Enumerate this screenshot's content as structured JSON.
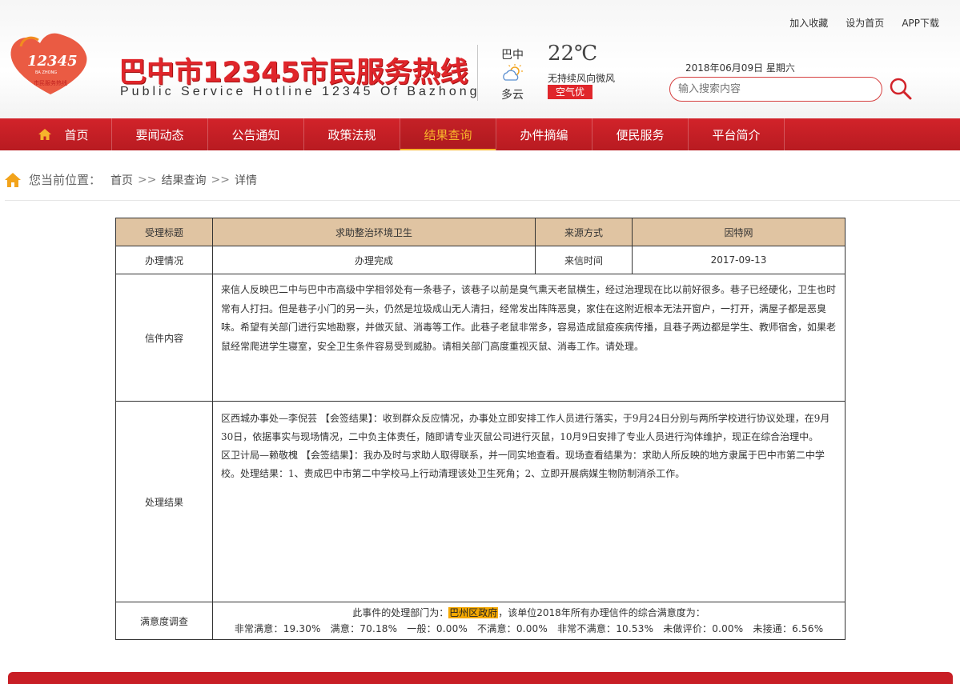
{
  "top_links": [
    "加入收藏",
    "设为首页",
    "APP下载"
  ],
  "logo": {
    "number": "12345",
    "sub_en": "BA ZHONG",
    "sub_cn": "市民服务热线"
  },
  "site_title_cn": "巴中市12345市民服务热线",
  "site_title_en": "Public Service Hotline 12345 Of Bazhong",
  "weather": {
    "city": "巴中",
    "desc": "多云",
    "temp": "22℃",
    "wind": "无持续风向微风",
    "aqi": "空气优"
  },
  "date": "2018年06月09日  星期六",
  "search": {
    "placeholder": "输入搜索内容"
  },
  "nav": {
    "items": [
      {
        "label": "首页"
      },
      {
        "label": "要闻动态"
      },
      {
        "label": "公告通知"
      },
      {
        "label": "政策法规"
      },
      {
        "label": "结果查询"
      },
      {
        "label": "办件摘编"
      },
      {
        "label": "便民服务"
      },
      {
        "label": "平台简介"
      }
    ],
    "active_index": 4
  },
  "breadcrumb": {
    "label": "您当前位置：",
    "items": [
      "首页",
      "结果查询",
      "详情"
    ],
    "sep": ">>"
  },
  "detail": {
    "row1": {
      "title_label": "受理标题",
      "title_value": "求助整治环境卫生",
      "source_label": "来源方式",
      "source_value": "因特网"
    },
    "row2": {
      "status_label": "办理情况",
      "status_value": "办理完成",
      "time_label": "来信时间",
      "time_value": "2017-09-13"
    },
    "content_label": "信件内容",
    "content": "来信人反映巴二中与巴中市高级中学相邻处有一条巷子，该巷子以前是臭气熏天老鼠横生，经过治理现在比以前好很多。巷子已经硬化，卫生也时常有人打扫。但是巷子小门的另一头，仍然是垃圾成山无人清扫，经常发出阵阵恶臭，家住在这附近根本无法开窗户，一打开，满屋子都是恶臭味。希望有关部门进行实地勘察，并做灭鼠、消毒等工作。此巷子老鼠非常多，容易造成鼠疫疾病传播，且巷子两边都是学生、教师宿舍，如果老鼠经常爬进学生寝室，安全卫生条件容易受到威胁。请相关部门高度重视灭鼠、消毒工作。请处理。",
    "result_label": "处理结果",
    "result_1": "区西城办事处—李倪芸 【会签结果】：收到群众反应情况，办事处立即安排工作人员进行落实，于9月24日分别与两所学校进行协议处理，在9月30日，依据事实与现场情况，二中负主体责任，随即请专业灭鼠公司进行灭鼠，10月9日安排了专业人员进行沟体维护，现正在综合治理中。",
    "result_2": "区卫计局—赖敬槐 【会签结果】：我办及时与求助人取得联系，并一同实地查看。现场查看结果为：求助人所反映的地方隶属于巴中市第二中学校。处理结果：1、责成巴中市第二中学校马上行动清理该处卫生死角；2、立即开展病媒生物防制消杀工作。",
    "satisfaction_label": "满意度调查",
    "sat_prefix": "此事件的处理部门为：",
    "sat_dept": "巴州区政府",
    "sat_suffix": "，该单位2018年所有办理信件的综合满意度为：",
    "sat_stats": "非常满意：19.30%   满意：70.18%   一般：0.00%   不满意：0.00%   非常不满意：10.53%   未做评价：0.00%   未接通：6.56%"
  },
  "colors": {
    "brand_red": "#d2232a",
    "active_nav": "#f7b32b",
    "table_header": "#e0c4a2",
    "highlight": "#f5a800"
  }
}
